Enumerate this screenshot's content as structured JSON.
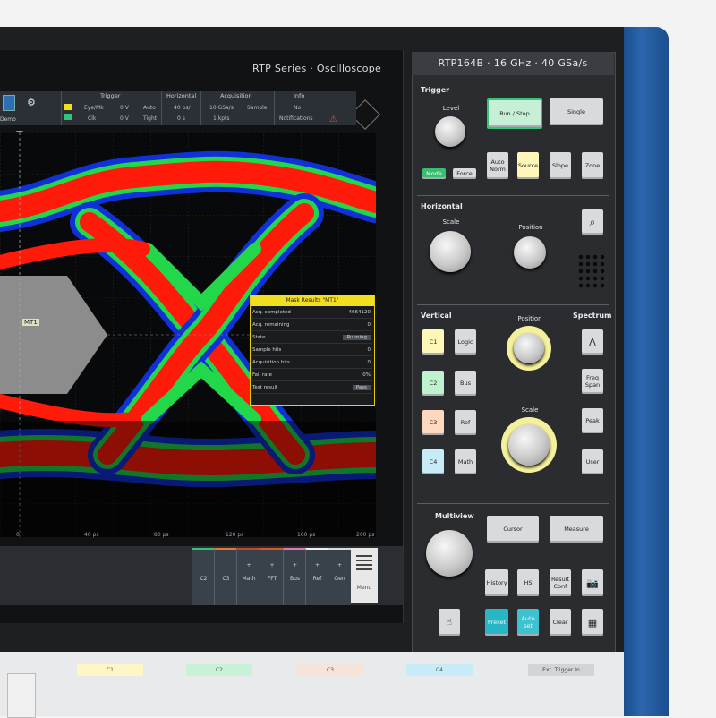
{
  "device": {
    "brand_line": "RTP Series · Oscilloscope",
    "model": "RTP164B · 16 GHz · 40 GSa/s"
  },
  "screen": {
    "demo_label": "Demo",
    "infobar": {
      "headers": [
        "Trigger",
        "Horizontal",
        "Acquisition",
        "Info"
      ],
      "trigger_rows": [
        [
          "Eye/Mk",
          "0 V",
          "Auto"
        ],
        [
          "Clk",
          "0 V",
          "Tight"
        ]
      ],
      "horizontal": [
        "40 ps/",
        "0 s"
      ],
      "acquisition": [
        "10 GSa/s",
        "1 kpts",
        "Sample"
      ],
      "info": [
        "No",
        "Notifications"
      ]
    },
    "mask_tag": "MT1",
    "time_ticks": [
      "0",
      "40 ps",
      "80 ps",
      "120 ps",
      "160 ps",
      "200 ps"
    ],
    "bottom_tiles": [
      "C2",
      "C3",
      "Math",
      "FFT",
      "Bus",
      "Ref",
      "Gen"
    ],
    "menu_label": "Menu",
    "mask_results": {
      "title": "Mask Results \"MT1\"",
      "rows": [
        {
          "label": "Acq. completed",
          "value": "4664120"
        },
        {
          "label": "Acq. remaining",
          "value": "0"
        },
        {
          "label": "State",
          "value": "Running"
        },
        {
          "label": "Sample hits",
          "value": "0"
        },
        {
          "label": "Acquisition hits",
          "value": "0"
        },
        {
          "label": "Fail rate",
          "value": "0%"
        },
        {
          "label": "Test result",
          "value": "Pass"
        }
      ]
    }
  },
  "panel": {
    "trigger": {
      "title": "Trigger",
      "knob_label": "Level",
      "run_stop": "Run / Stop",
      "single": "Single",
      "toggle_a": "Mode",
      "toggle_b": "Force",
      "buttons": [
        "Auto Norm",
        "Source",
        "Slope",
        "Zone"
      ]
    },
    "horizontal": {
      "title": "Horizontal",
      "scale_label": "Scale",
      "position_label": "Position",
      "zoom_icon": "zoom-icon"
    },
    "vertical": {
      "title": "Vertical",
      "channels": [
        "C1",
        "C2",
        "C3",
        "C4"
      ],
      "mid_buttons": [
        "Logic",
        "Bus",
        "Ref",
        "Math"
      ],
      "position_label": "Position",
      "scale_label": "Scale"
    },
    "spectrum": {
      "title": "Spectrum",
      "buttons": [
        "Freq Span",
        "Peak",
        "User"
      ],
      "icon": "spectrum-icon"
    },
    "multiview": {
      "title": "Multiview",
      "cursor": "Cursor",
      "measure": "Measure",
      "row1": [
        "History",
        "HS",
        "Result Conf",
        "camera-icon"
      ],
      "row2": [
        "touch-icon",
        "Preset",
        "Auto set",
        "Clear",
        "apps-icon"
      ]
    }
  },
  "front": {
    "channels": [
      "C1",
      "C2",
      "C3",
      "C4"
    ],
    "ext_trigger": "Ext. Trigger In"
  },
  "colors": {
    "eye_red": "#ff1a0a",
    "eye_green": "#22d84a",
    "eye_blue": "#1030d8",
    "frame_blue": "#1b4e8e"
  }
}
